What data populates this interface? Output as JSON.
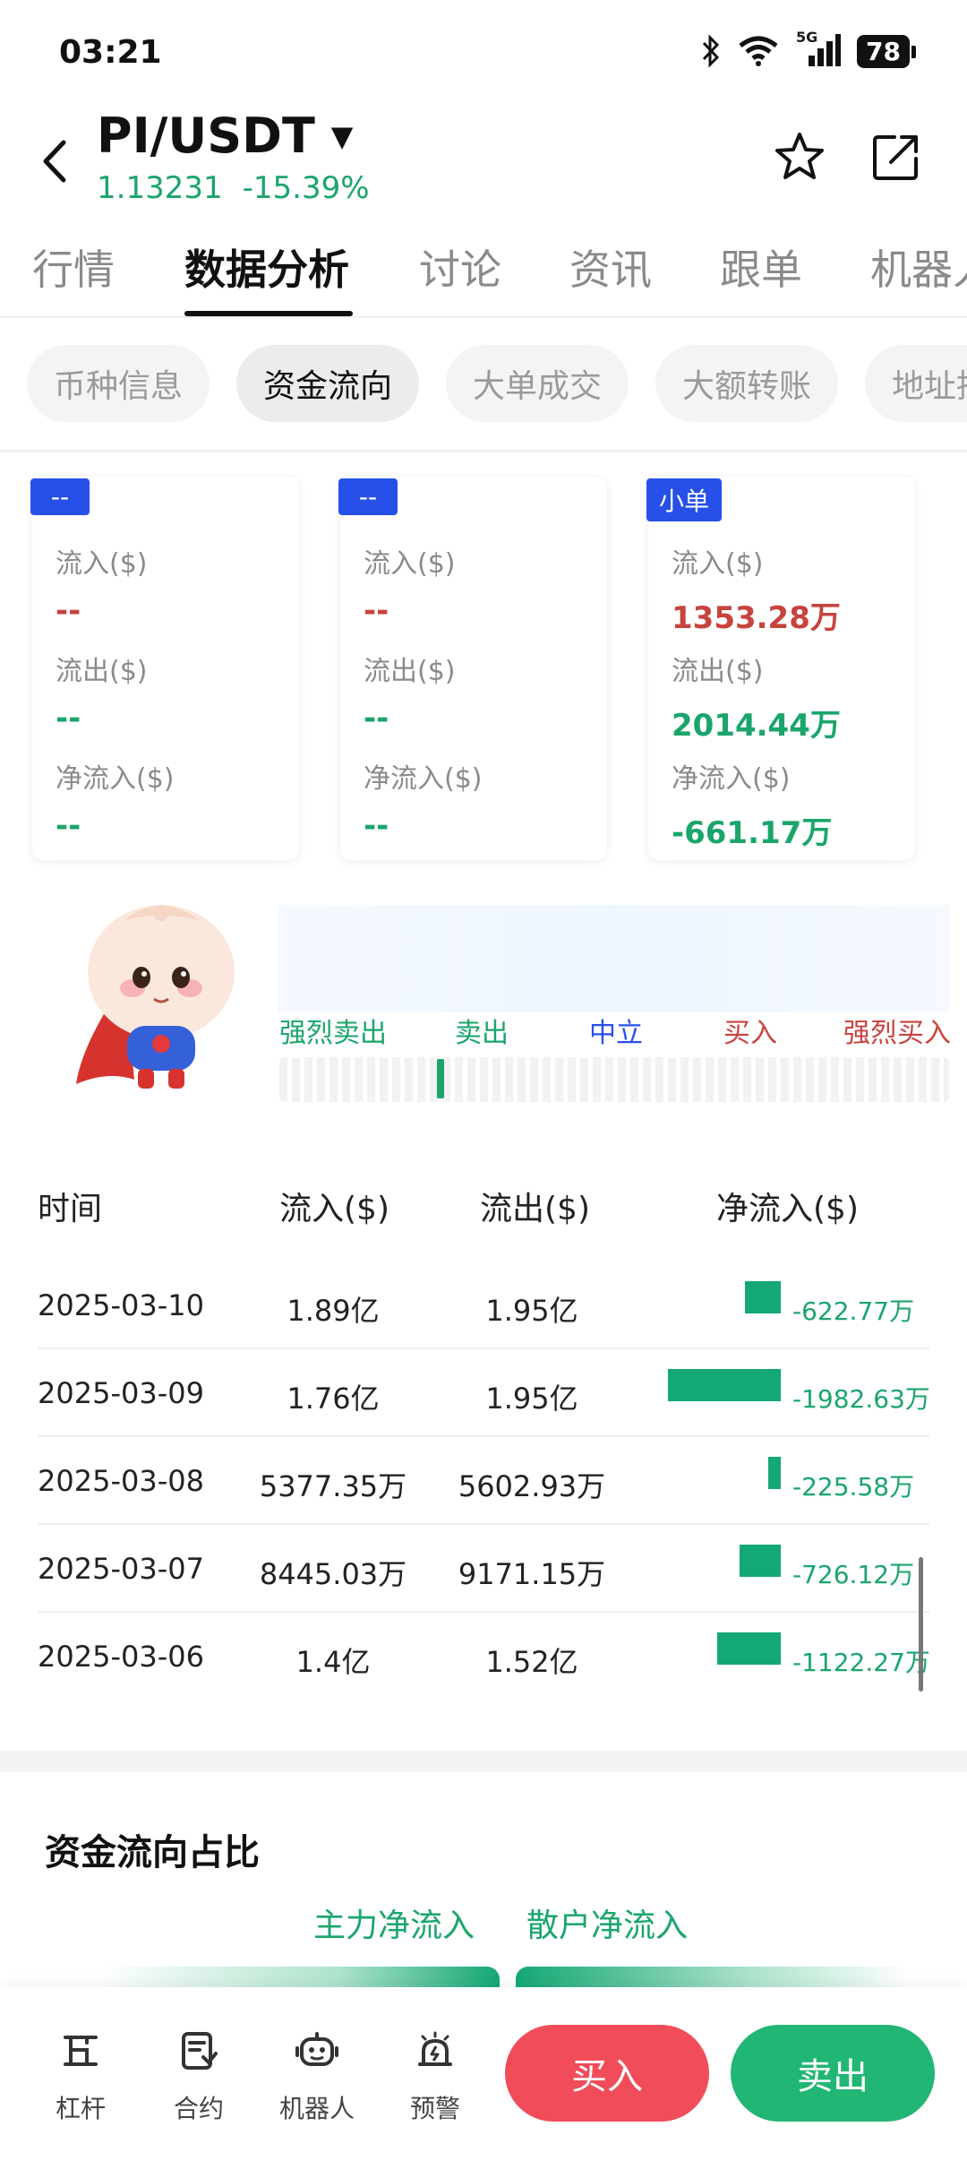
{
  "status_bar": {
    "time": "03:21",
    "network": "5G",
    "battery": "78"
  },
  "header": {
    "pair": "PI/USDT",
    "price": "1.13231",
    "change": "-15.39%"
  },
  "main_tabs": [
    "行情",
    "数据分析",
    "讨论",
    "资讯",
    "跟单",
    "机器人"
  ],
  "sub_tabs": [
    "币种信息",
    "资金流向",
    "大单成交",
    "大额转账",
    "地址持仓"
  ],
  "flow_cards": [
    {
      "badge": "--",
      "inflow_label": "流入($)",
      "inflow": "--",
      "outflow_label": "流出($)",
      "outflow": "--",
      "net_label": "净流入($)",
      "net": "--"
    },
    {
      "badge": "--",
      "inflow_label": "流入($)",
      "inflow": "--",
      "outflow_label": "流出($)",
      "outflow": "--",
      "net_label": "净流入($)",
      "net": "--"
    },
    {
      "badge": "小单",
      "inflow_label": "流入($)",
      "inflow": "1353.28万",
      "outflow_label": "流出($)",
      "outflow": "2014.44万",
      "net_label": "净流入($)",
      "net": "-661.17万"
    }
  ],
  "sentiment": {
    "labels": [
      "强烈卖出",
      "卖出",
      "中立",
      "买入",
      "强烈买入"
    ],
    "colors": [
      "#1aa56b",
      "#1aa56b",
      "#2750e8",
      "#c7433e",
      "#c7433e"
    ],
    "level": 0.24
  },
  "table": {
    "headers": [
      "时间",
      "流入($)",
      "流出($)",
      "净流入($)"
    ],
    "rows": [
      {
        "date": "2025-03-10",
        "in": "1.89亿",
        "out": "1.95亿",
        "net": "-622.77万",
        "net_value": -622.77
      },
      {
        "date": "2025-03-09",
        "in": "1.76亿",
        "out": "1.95亿",
        "net": "-1982.63万",
        "net_value": -1982.63
      },
      {
        "date": "2025-03-08",
        "in": "5377.35万",
        "out": "5602.93万",
        "net": "-225.58万",
        "net_value": -225.58
      },
      {
        "date": "2025-03-07",
        "in": "8445.03万",
        "out": "9171.15万",
        "net": "-726.12万",
        "net_value": -726.12
      },
      {
        "date": "2025-03-06",
        "in": "1.4亿",
        "out": "1.52亿",
        "net": "-1122.27万",
        "net_value": -1122.27
      }
    ]
  },
  "ratio": {
    "title": "资金流向占比",
    "legend": [
      "主力净流入",
      "散户净流入"
    ]
  },
  "bottom_nav": [
    {
      "label": "杠杆",
      "icon": "leverage-icon"
    },
    {
      "label": "合约",
      "icon": "contract-icon"
    },
    {
      "label": "机器人",
      "icon": "robot-icon"
    },
    {
      "label": "预警",
      "icon": "alert-icon"
    }
  ],
  "actions": {
    "buy": "买入",
    "sell": "卖出"
  },
  "colors": {
    "green": "#1aa56b",
    "red": "#c7433e",
    "blue": "#2750e8",
    "buy": "#f04c5a",
    "sell": "#22b675"
  }
}
